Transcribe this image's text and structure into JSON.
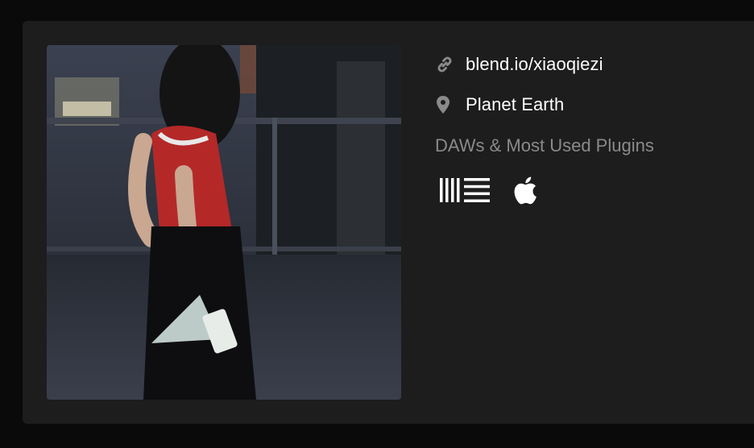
{
  "profile": {
    "photo_alt": "",
    "link": "blend.io/xiaoqiezi",
    "location": "Planet Earth",
    "link_icon": "link-icon",
    "location_icon": "map-pin-icon"
  },
  "daws_section": {
    "title": "DAWs & Most Used Plugins",
    "items": [
      {
        "icon": "ableton-live-icon"
      },
      {
        "icon": "apple-logic-icon"
      }
    ]
  },
  "colors": {
    "background": "#0a0a0a",
    "card": "#1d1d1d",
    "text": "#ffffff",
    "muted": "#8a8a8a",
    "icon": "#8a8a8a"
  }
}
